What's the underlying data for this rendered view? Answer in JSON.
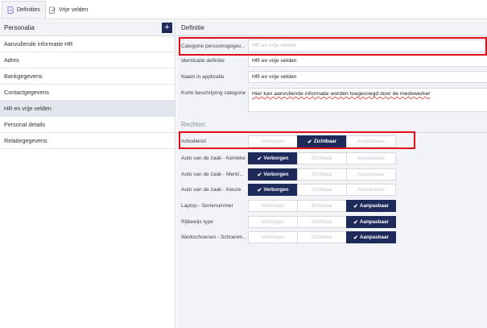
{
  "tabs": [
    {
      "label": "Definities",
      "active": true,
      "icon": "document-icon"
    },
    {
      "label": "Vrije velden",
      "active": false,
      "icon": "edit-icon"
    }
  ],
  "left_panel": {
    "title": "Personalia",
    "add_label": "+",
    "items": [
      {
        "label": "Aanvullende informatie HR",
        "selected": false
      },
      {
        "label": "Adres",
        "selected": false
      },
      {
        "label": "Bankgegevens",
        "selected": false
      },
      {
        "label": "Contactgegevens",
        "selected": false
      },
      {
        "label": "HR en vrije velden",
        "selected": true
      },
      {
        "label": "Personal details",
        "selected": false
      },
      {
        "label": "Relatiegegevens",
        "selected": false
      }
    ]
  },
  "definition": {
    "title": "Definitie",
    "fields": [
      {
        "label": "Categorie persoonsgegev...",
        "value": "HR en vrije velden",
        "placeholder": true
      },
      {
        "label": "Identicatie definitie",
        "value": "HR en vrije velden",
        "placeholder": false
      },
      {
        "label": "Naam in applicatie",
        "value": "HR en vrije velden",
        "placeholder": false
      },
      {
        "label": "Korte beschrijving categorie",
        "value": "Hier kan aanvullende informatie worden toegevoegd door de medewerker",
        "placeholder": false
      }
    ]
  },
  "rights": {
    "title": "Rechten",
    "options": [
      "Verborgen",
      "Zichtbaar",
      "Aanpasbaar"
    ],
    "rows": [
      {
        "label": "Arbodienst",
        "selected": 1
      },
      {
        "label": "Auto van de zaak - Kenteken",
        "selected": 0
      },
      {
        "label": "Auto van de zaak - Merk/...",
        "selected": 0
      },
      {
        "label": "Auto van de zaak - Keuze",
        "selected": 0
      },
      {
        "label": "Laptop - Serienummer",
        "selected": 2
      },
      {
        "label": "Rijbewijs type",
        "selected": 2
      },
      {
        "label": "Werkschoenen - Schoenm...",
        "selected": 2
      }
    ]
  },
  "colors": {
    "accent": "#1e2a5a",
    "highlight": "#e3101a",
    "panel_bg": "#f1f3f6"
  }
}
